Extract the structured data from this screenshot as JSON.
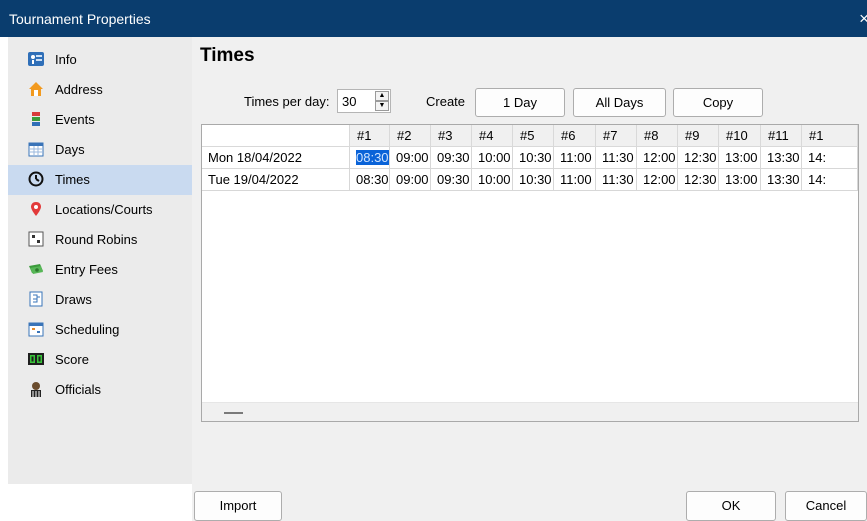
{
  "window": {
    "title": "Tournament Properties",
    "close": "×"
  },
  "sidebar": {
    "items": [
      {
        "label": "Info",
        "icon": "info-icon"
      },
      {
        "label": "Address",
        "icon": "home-icon"
      },
      {
        "label": "Events",
        "icon": "events-icon"
      },
      {
        "label": "Days",
        "icon": "calendar-icon"
      },
      {
        "label": "Times",
        "icon": "clock-icon",
        "selected": true
      },
      {
        "label": "Locations/Courts",
        "icon": "location-pin-icon"
      },
      {
        "label": "Round Robins",
        "icon": "round-robin-icon"
      },
      {
        "label": "Entry Fees",
        "icon": "money-icon"
      },
      {
        "label": "Draws",
        "icon": "draw-icon"
      },
      {
        "label": "Scheduling",
        "icon": "schedule-icon"
      },
      {
        "label": "Score",
        "icon": "score-icon"
      },
      {
        "label": "Officials",
        "icon": "official-icon"
      }
    ]
  },
  "page": {
    "title": "Times"
  },
  "controls": {
    "times_per_day_label": "Times per day:",
    "times_per_day_value": "30",
    "create_label": "Create",
    "one_day_button": "1 Day",
    "all_days_button": "All Days",
    "copy_button": "Copy"
  },
  "grid": {
    "columns": [
      "#1",
      "#2",
      "#3",
      "#4",
      "#5",
      "#6",
      "#7",
      "#8",
      "#9",
      "#10",
      "#11",
      "#1"
    ],
    "rows": [
      {
        "label": "Mon 18/04/2022",
        "cells": [
          "08:30",
          "09:00",
          "09:30",
          "10:00",
          "10:30",
          "11:00",
          "11:30",
          "12:00",
          "12:30",
          "13:00",
          "13:30",
          "14:"
        ]
      },
      {
        "label": "Tue 19/04/2022",
        "cells": [
          "08:30",
          "09:00",
          "09:30",
          "10:00",
          "10:30",
          "11:00",
          "11:30",
          "12:00",
          "12:30",
          "13:00",
          "13:30",
          "14:"
        ]
      }
    ]
  },
  "footer": {
    "import_button": "Import",
    "ok_button": "OK",
    "cancel_button": "Cancel"
  },
  "colors": {
    "titlebar": "#0a3d6e",
    "selection": "#c9daf0",
    "cell_highlight": "#0a63d8"
  }
}
